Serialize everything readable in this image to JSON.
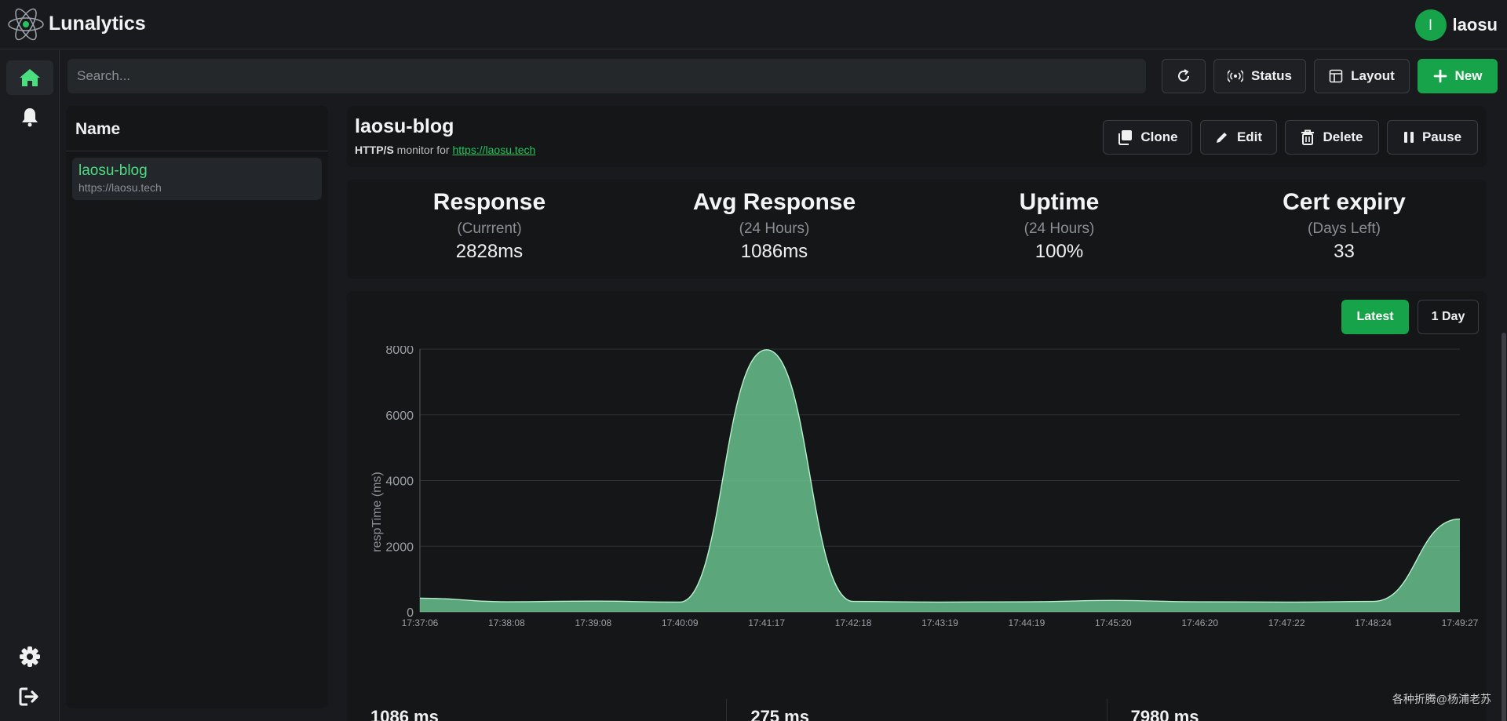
{
  "app": {
    "title": "Lunalytics",
    "user_initial": "l",
    "username": "laosu"
  },
  "search": {
    "placeholder": "Search..."
  },
  "toolbar": {
    "status_label": "Status",
    "layout_label": "Layout",
    "new_label": "New"
  },
  "list": {
    "header": "Name",
    "items": [
      {
        "name": "laosu-blog",
        "url": "https://laosu.tech"
      }
    ]
  },
  "monitor": {
    "name": "laosu-blog",
    "type": "HTTP/S",
    "sub_text": "monitor for",
    "url": "https://laosu.tech",
    "actions": {
      "clone": "Clone",
      "edit": "Edit",
      "delete": "Delete",
      "pause": "Pause"
    }
  },
  "stats": [
    {
      "title": "Response",
      "sub": "(Currrent)",
      "value": "2828ms"
    },
    {
      "title": "Avg Response",
      "sub": "(24 Hours)",
      "value": "1086ms"
    },
    {
      "title": "Uptime",
      "sub": "(24 Hours)",
      "value": "100%"
    },
    {
      "title": "Cert expiry",
      "sub": "(Days Left)",
      "value": "33"
    }
  ],
  "chart_controls": {
    "latest": "Latest",
    "day": "1 Day"
  },
  "chart_data": {
    "type": "area",
    "ylabel": "respTime (ms)",
    "ylim": [
      0,
      8000
    ],
    "yticks": [
      0,
      2000,
      4000,
      6000,
      8000
    ],
    "categories": [
      "17:37:06",
      "17:38:08",
      "17:39:08",
      "17:40:09",
      "17:41:17",
      "17:42:18",
      "17:43:19",
      "17:44:19",
      "17:45:20",
      "17:46:20",
      "17:47:22",
      "17:48:24",
      "17:49:27"
    ],
    "values": [
      420,
      310,
      330,
      300,
      7980,
      320,
      300,
      310,
      350,
      310,
      300,
      320,
      2828
    ],
    "grid": true,
    "color": "#6fcf97"
  },
  "summary": [
    "1086 ms",
    "275 ms",
    "7980 ms"
  ],
  "watermark": "各种折腾@杨浦老苏"
}
